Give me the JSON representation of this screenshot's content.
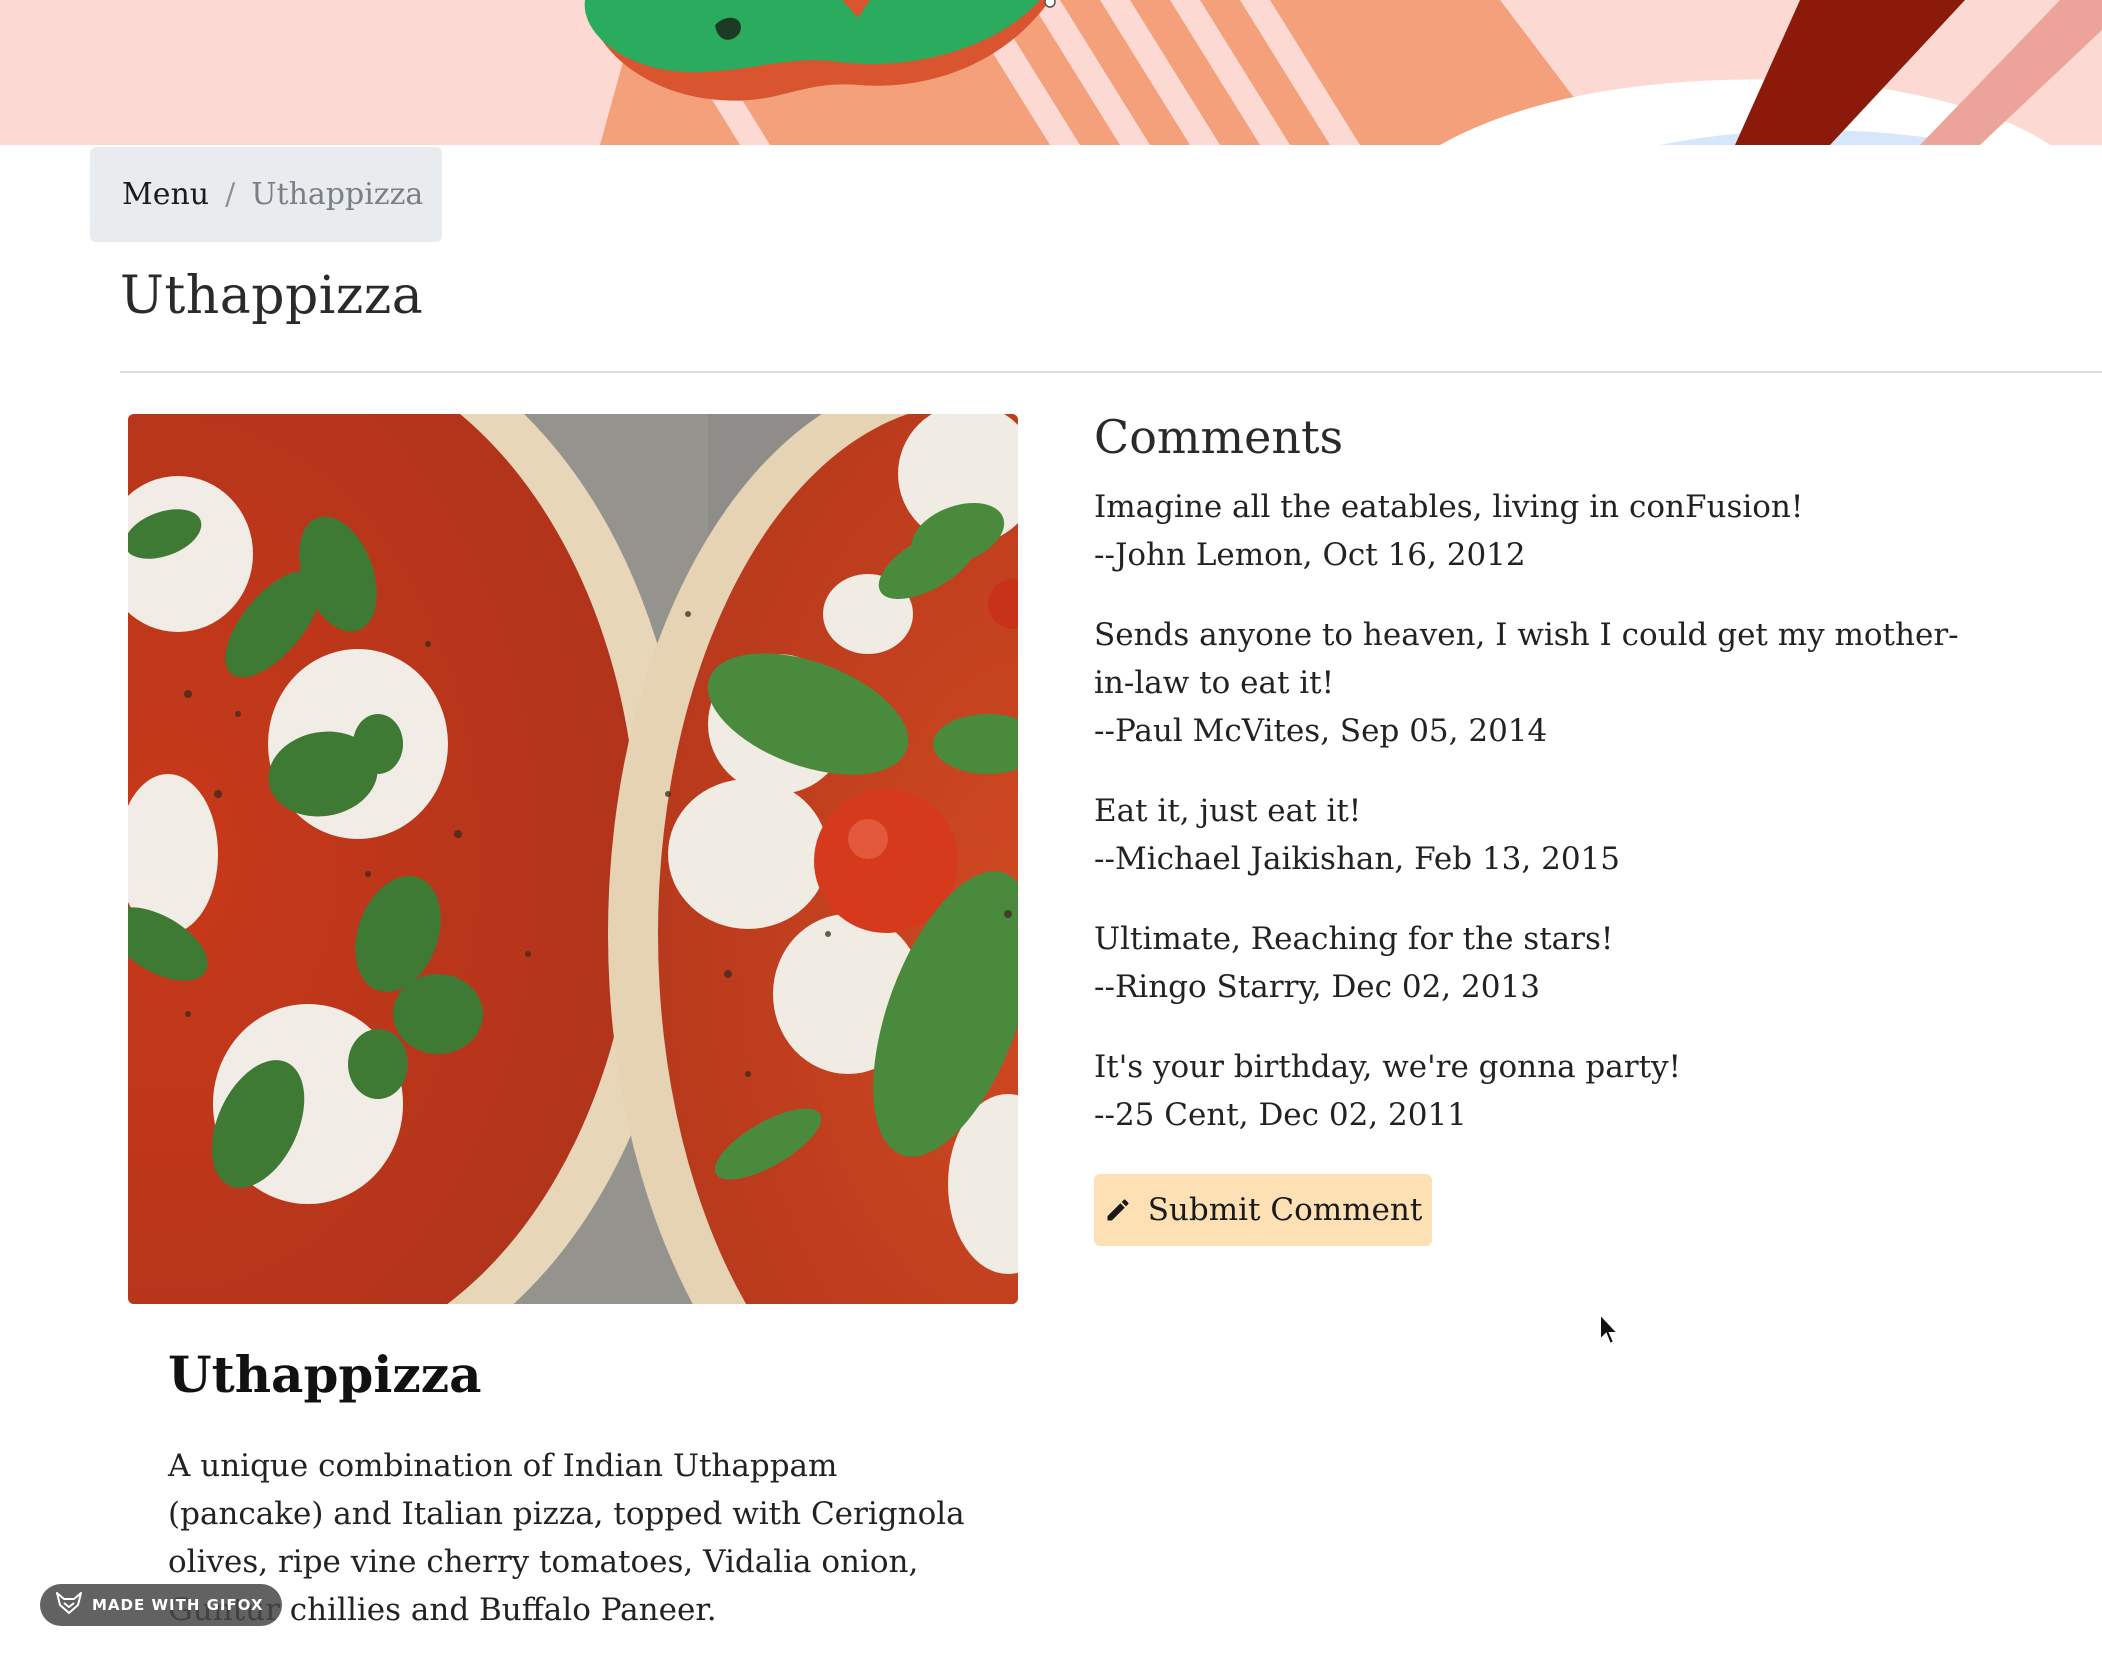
{
  "breadcrumb": {
    "items": [
      "Menu",
      "Uthappizza"
    ],
    "separator": "/"
  },
  "page": {
    "title": "Uthappizza"
  },
  "dish": {
    "name": "Uthappizza",
    "description": "A unique combination of Indian Uthappam (pancake) and Italian pizza, topped with Cerignola olives, ripe vine cherry tomatoes, Vidalia onion, Guntur chillies and Buffalo Paneer.",
    "image_icon": "pizza-photo"
  },
  "comments": {
    "heading": "Comments",
    "items": [
      {
        "text": "Imagine all the eatables, living in conFusion!",
        "byline": "--John Lemon, Oct 16, 2012"
      },
      {
        "text": "Sends anyone to heaven, I wish I could get my mother-in-law to eat it!",
        "byline": "--Paul McVites, Sep 05, 2014"
      },
      {
        "text": "Eat it, just eat it!",
        "byline": "--Michael Jaikishan, Feb 13, 2015"
      },
      {
        "text": "Ultimate, Reaching for the stars!",
        "byline": "--Ringo Starry, Dec 02, 2013"
      },
      {
        "text": "It's your birthday, we're gonna party!",
        "byline": "--25 Cent, Dec 02, 2011"
      }
    ],
    "submit_label": "Submit Comment",
    "submit_icon": "pencil-icon"
  },
  "watermark": {
    "label": "MADE WITH GIFOX",
    "icon": "fox-icon"
  },
  "colors": {
    "banner_background": "#fdd9d4",
    "banner_stripes": "#f4a07a",
    "banner_green": "#2aab5e",
    "banner_dark_red": "#8b1a0a",
    "breadcrumb_background": "#e9ecef",
    "submit_button_background": "#fde0b4"
  }
}
